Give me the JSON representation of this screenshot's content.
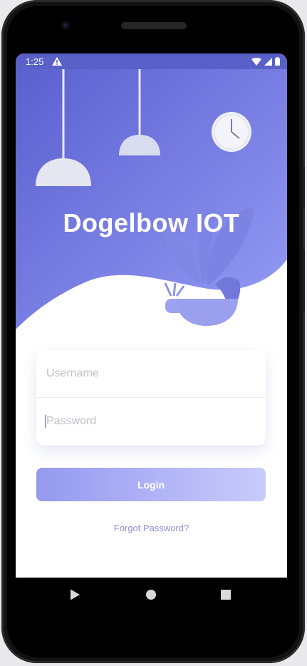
{
  "status_bar": {
    "time": "1:25"
  },
  "app": {
    "title": "Dogelbow IOT"
  },
  "login_form": {
    "username_placeholder": "Username",
    "password_placeholder": "Password",
    "login_label": "Login",
    "forgot_label": "Forgot Password?"
  },
  "colors": {
    "hero_start": "#5a60cf",
    "hero_end": "#8f96ee",
    "button_start": "#9599f0",
    "button_end": "#c9cbfb",
    "link": "#8b8fdc"
  },
  "icons": [
    "warning-icon",
    "wifi-icon",
    "signal-icon",
    "battery-icon",
    "back-icon",
    "home-icon",
    "recents-icon",
    "lamp-icon",
    "clock-icon",
    "plant-icon"
  ]
}
